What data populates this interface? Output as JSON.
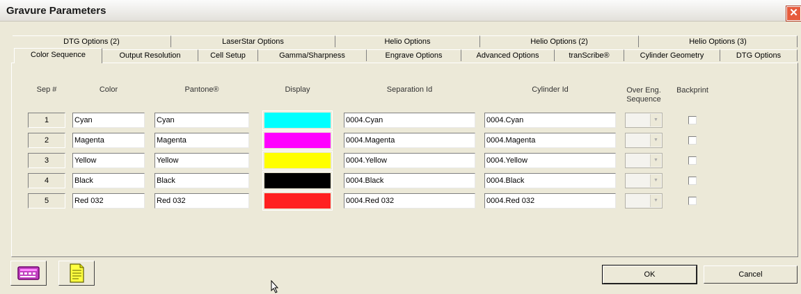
{
  "window": {
    "title": "Gravure Parameters",
    "close_glyph": "✕"
  },
  "tabs_row1": [
    "DTG Options (2)",
    "LaserStar Options",
    "Helio Options",
    "Helio Options (2)",
    "Helio Options (3)"
  ],
  "tabs_row2": [
    "Color Sequence",
    "Output Resolution",
    "Cell Setup",
    "Gamma/Sharpness",
    "Engrave Options",
    "Advanced Options",
    "tranScribe®",
    "Cylinder Geometry",
    "DTG Options"
  ],
  "active_tab": "Color Sequence",
  "headers": {
    "sep": "Sep #",
    "color": "Color",
    "pantone": "Pantone®",
    "display": "Display",
    "separation": "Separation Id",
    "cylinder": "Cylinder Id",
    "overeng_1": "Over Eng.",
    "overeng_2": "Sequence",
    "backprint": "Backprint"
  },
  "rows": [
    {
      "sep": "1",
      "color": "Cyan",
      "pantone": "Cyan",
      "swatch": "#00ffff",
      "separation": "0004.Cyan",
      "cylinder": "0004.Cyan",
      "backprint": false
    },
    {
      "sep": "2",
      "color": "Magenta",
      "pantone": "Magenta",
      "swatch": "#ff00ff",
      "separation": "0004.Magenta",
      "cylinder": "0004.Magenta",
      "backprint": false
    },
    {
      "sep": "3",
      "color": "Yellow",
      "pantone": "Yellow",
      "swatch": "#ffff00",
      "separation": "0004.Yellow",
      "cylinder": "0004.Yellow",
      "backprint": false
    },
    {
      "sep": "4",
      "color": "Black",
      "pantone": "Black",
      "swatch": "#000000",
      "separation": "0004.Black",
      "cylinder": "0004.Black",
      "backprint": false
    },
    {
      "sep": "5",
      "color": "Red 032",
      "pantone": "Red 032",
      "swatch": "#ff2020",
      "separation": "0004.Red 032",
      "cylinder": "0004.Red 032",
      "backprint": false
    }
  ],
  "buttons": {
    "ok": "OK",
    "cancel": "Cancel"
  },
  "icons": {
    "left": "keyboard-icon",
    "right": "document-icon"
  }
}
